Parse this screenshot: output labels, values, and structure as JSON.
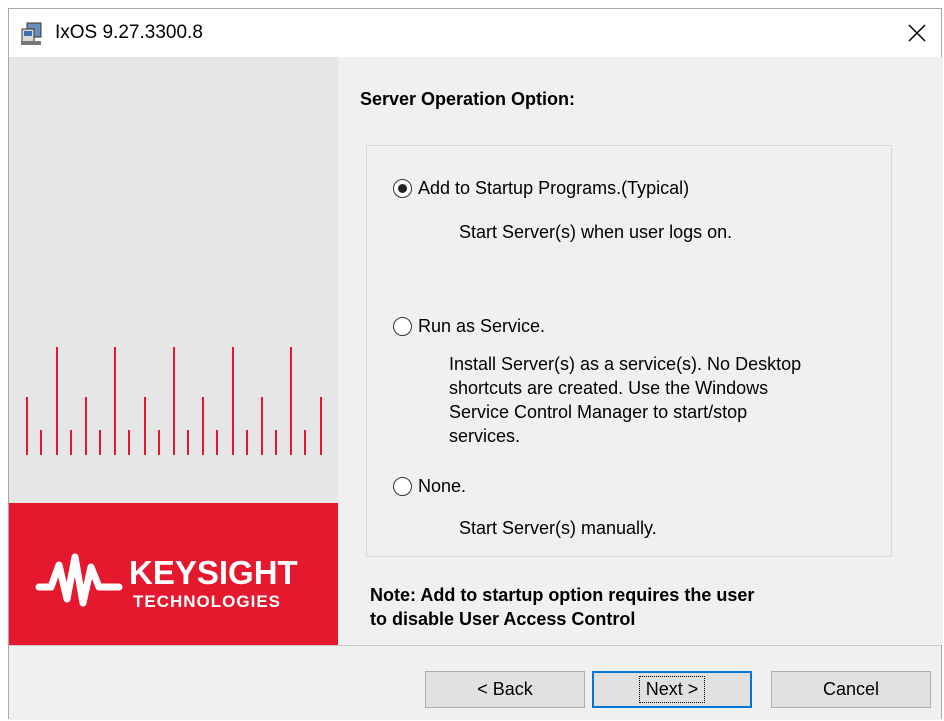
{
  "window": {
    "title": "IxOS 9.27.3300.8"
  },
  "brand": {
    "name": "KEYSIGHT",
    "sub": "TECHNOLOGIES",
    "color": "#e5182d"
  },
  "page": {
    "heading": "Server Operation Option:",
    "options": [
      {
        "label": "Add to Startup Programs.(Typical)",
        "selected": true,
        "description": [
          "Start Server(s) when user logs on."
        ]
      },
      {
        "label": "Run as Service.",
        "selected": false,
        "description": [
          "Install Server(s) as a service(s). No Desktop",
          "shortcuts are created.  Use the Windows",
          "Service Control Manager to start/stop",
          "services."
        ]
      },
      {
        "label": "None.",
        "selected": false,
        "description": [
          "Start Server(s) manually."
        ]
      }
    ],
    "note": [
      "Note: Add to startup option requires the user",
      "to disable User Access Control"
    ]
  },
  "buttons": {
    "back": "< Back",
    "next": "Next >",
    "cancel": "Cancel"
  },
  "icons": {
    "app": "installer-icon",
    "close": "close-icon",
    "logo": "keysight-wave-icon"
  }
}
